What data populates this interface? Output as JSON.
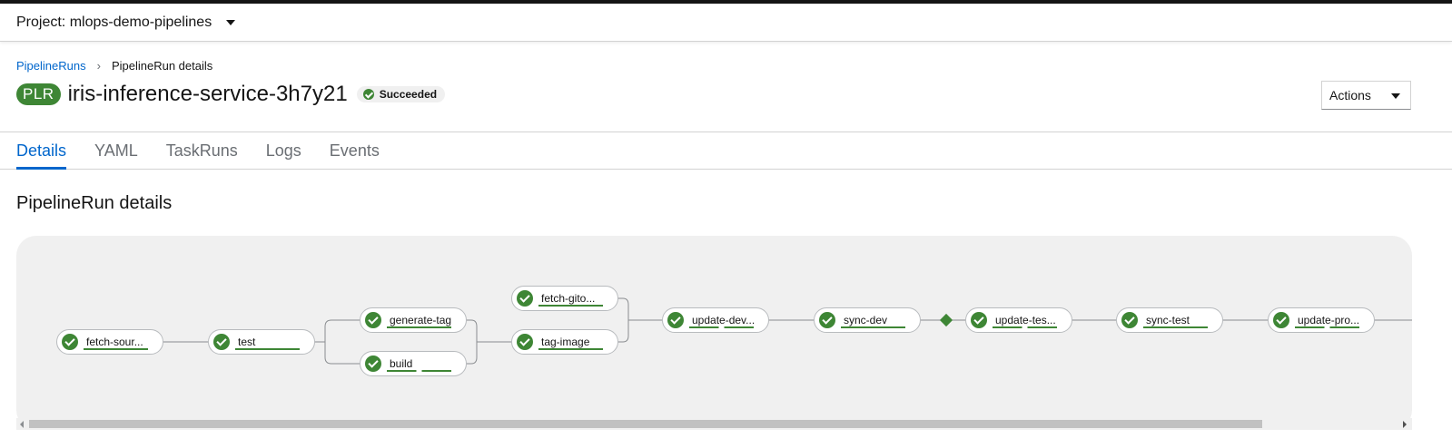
{
  "project": {
    "label": "Project: mlops-demo-pipelines"
  },
  "breadcrumb": {
    "parent": "PipelineRuns",
    "separator": "›",
    "current": "PipelineRun details"
  },
  "header": {
    "badge": "PLR",
    "title": "iris-inference-service-3h7y21",
    "status": "Succeeded",
    "actions": "Actions"
  },
  "tabs": [
    {
      "label": "Details",
      "active": true
    },
    {
      "label": "YAML",
      "active": false
    },
    {
      "label": "TaskRuns",
      "active": false
    },
    {
      "label": "Logs",
      "active": false
    },
    {
      "label": "Events",
      "active": false
    }
  ],
  "section": {
    "title": "PipelineRun details"
  },
  "pipeline": {
    "tasks": [
      {
        "label": "fetch-sour...",
        "status": "succeeded"
      },
      {
        "label": "test",
        "status": "succeeded"
      },
      {
        "label": "generate-tag",
        "status": "succeeded"
      },
      {
        "label": "build",
        "status": "succeeded"
      },
      {
        "label": "fetch-gito...",
        "status": "succeeded"
      },
      {
        "label": "tag-image",
        "status": "succeeded"
      },
      {
        "label": "update-dev...",
        "status": "succeeded"
      },
      {
        "label": "sync-dev",
        "status": "succeeded"
      },
      {
        "label": "update-tes...",
        "status": "succeeded"
      },
      {
        "label": "sync-test",
        "status": "succeeded"
      },
      {
        "label": "update-pro...",
        "status": "succeeded"
      }
    ],
    "status_color": "#3e8635"
  },
  "colors": {
    "accent": "#0066cc",
    "success": "#3e8635"
  }
}
